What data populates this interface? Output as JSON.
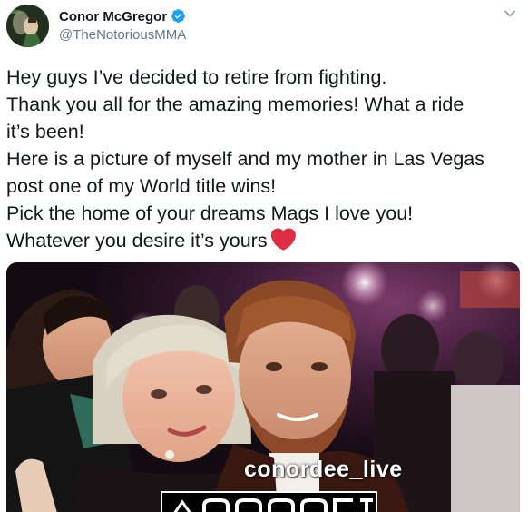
{
  "author": {
    "display_name": "Conor McGregor",
    "handle": "@TheNotoriousMMA",
    "verified": true,
    "avatar_icon": "profile-avatar"
  },
  "tweet": {
    "lines": [
      "Hey guys I’ve decided to retire from fighting.",
      "Thank you all for the amazing memories! What a ride",
      "it’s been!",
      "Here is a picture of myself and my mother in Las Vegas",
      "post one of my World title wins!",
      "Pick the home of your dreams Mags I love you!",
      "Whatever you desire it’s yours"
    ],
    "emoji": "red-heart"
  },
  "photo": {
    "watermark": "conordee_live"
  },
  "colors": {
    "verified": "#1da1f2",
    "handle": "#657786",
    "heart": "#dd2e44",
    "text": "#14171a"
  }
}
